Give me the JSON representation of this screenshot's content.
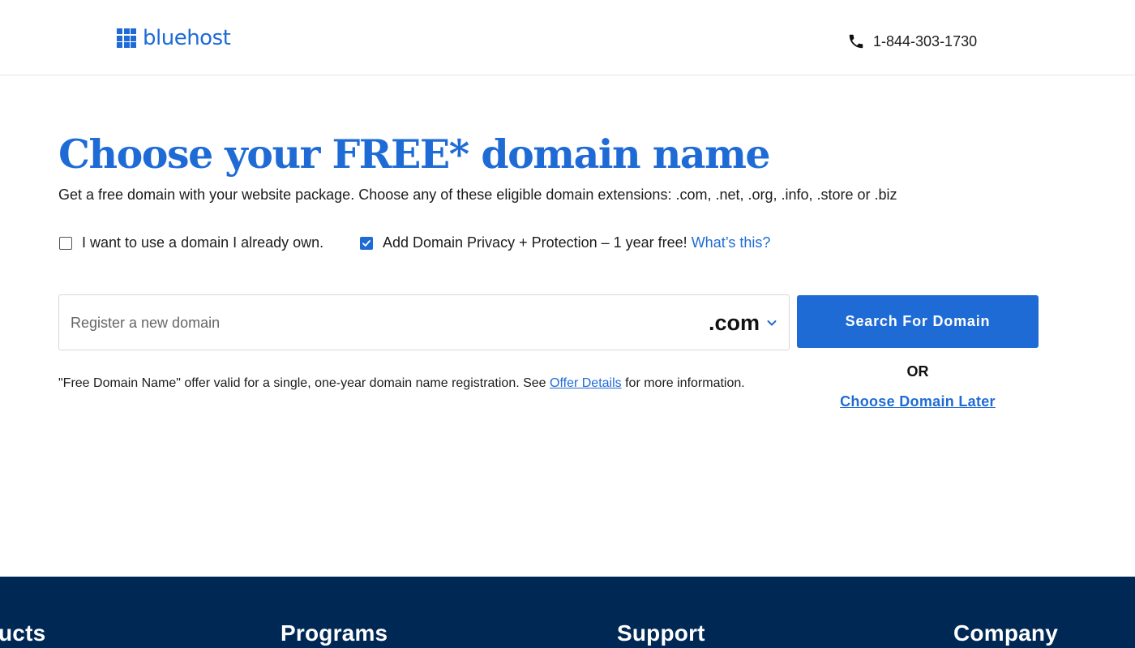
{
  "header": {
    "logo_text": "bluehost",
    "phone_icon": "phone-icon",
    "phone_number": "1-844-303-1730"
  },
  "colors": {
    "brand_blue": "#1f6bd6",
    "footer_navy": "#002855"
  },
  "main": {
    "title": "Choose your FREE* domain name",
    "subtitle": "Get a free domain with your website package. Choose any of these eligible domain extensions: .com, .net, .org, .info, .store or .biz",
    "options": {
      "own_domain": {
        "label": "I want to use a domain I already own.",
        "checked": false
      },
      "privacy": {
        "label": "Add Domain Privacy + Protection – 1 year free!",
        "checked": true,
        "link": "What’s this?"
      }
    },
    "search": {
      "placeholder": "Register a new domain",
      "value": "",
      "tld": ".com",
      "button": "Search For Domain"
    },
    "or_label": "OR",
    "choose_later": "Choose Domain Later",
    "disclaimer": {
      "before": "\"Free Domain Name\" offer valid for a single, one-year domain name registration. See ",
      "link": "Offer Details",
      "after": " for more information."
    }
  },
  "footer": {
    "headings": [
      "ucts",
      "Programs",
      "Support",
      "Company"
    ]
  }
}
